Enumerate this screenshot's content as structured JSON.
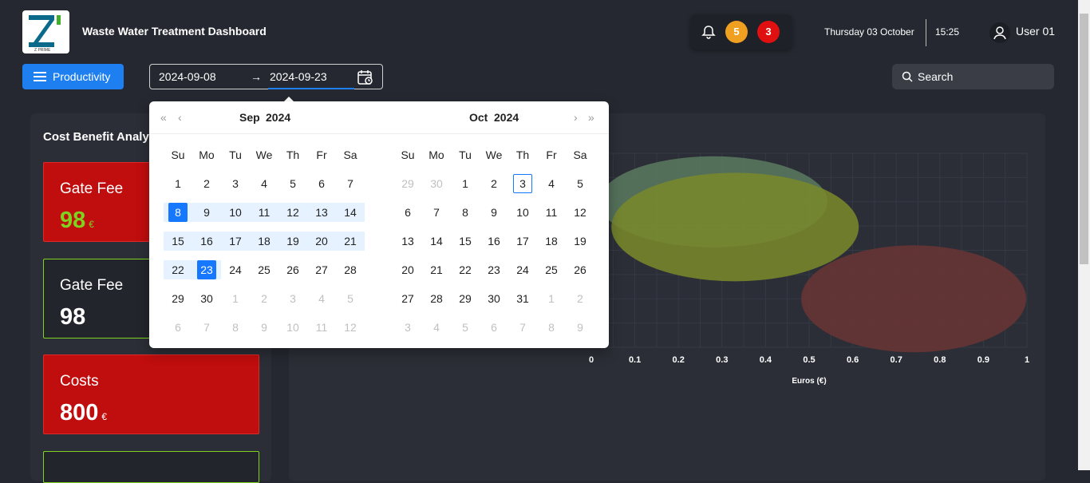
{
  "header": {
    "logo_text": "Z PRIME",
    "title": "Waste Water Treatment Dashboard",
    "notif_warn_count": "5",
    "notif_alert_count": "3",
    "date": "Thursday 03 October",
    "time": "15:25",
    "user": "User 01",
    "icons": [
      "bell-icon",
      "user-icon",
      "menu-icon",
      "calendar-icon",
      "search-icon"
    ],
    "colors": {
      "accent": "#1d7ff0",
      "warn": "#f0a020",
      "alert": "#e01010"
    }
  },
  "toolbar": {
    "productivity_label": "Productivity",
    "range_start": "2024-09-08",
    "range_arrow": "→",
    "range_end": "2024-09-23",
    "search_label": "Search"
  },
  "left_panel": {
    "title": "Cost Benefit Analy",
    "cards": [
      {
        "label": "Gate Fee",
        "value": "98",
        "unit": "€"
      },
      {
        "label": "Gate Fee",
        "value": "98",
        "unit": ""
      },
      {
        "label": "Costs",
        "value": "800",
        "unit": "€"
      }
    ]
  },
  "chart_data": {
    "type": "scatter",
    "xlabel": "Euros (€)",
    "xticks": [
      "0",
      "0.1",
      "0.2",
      "0.3",
      "0.4",
      "0.5",
      "0.6",
      "0.7",
      "0.8",
      "0.9",
      "1"
    ],
    "xlim": [
      0,
      1
    ],
    "bubbles": [
      {
        "x": 0.28,
        "y": 0.75,
        "color": "#5a7a60"
      },
      {
        "x": 0.33,
        "y": 0.62,
        "color": "#7a8a2a"
      },
      {
        "x": 0.74,
        "y": 0.25,
        "color": "#6a3434"
      }
    ]
  },
  "calendar": {
    "left_month": "Sep",
    "left_year": "2024",
    "right_month": "Oct",
    "right_year": "2024",
    "weekdays": [
      "Su",
      "Mo",
      "Tu",
      "We",
      "Th",
      "Fr",
      "Sa"
    ],
    "left_days": [
      [
        "1",
        "2",
        "3",
        "4",
        "5",
        "6",
        "7"
      ],
      [
        "8",
        "9",
        "10",
        "11",
        "12",
        "13",
        "14"
      ],
      [
        "15",
        "16",
        "17",
        "18",
        "19",
        "20",
        "21"
      ],
      [
        "22",
        "23",
        "24",
        "25",
        "26",
        "27",
        "28"
      ],
      [
        "29",
        "30",
        "1",
        "2",
        "3",
        "4",
        "5"
      ],
      [
        "6",
        "7",
        "8",
        "9",
        "10",
        "11",
        "12"
      ]
    ],
    "right_days": [
      [
        "29",
        "30",
        "1",
        "2",
        "3",
        "4",
        "5"
      ],
      [
        "6",
        "7",
        "8",
        "9",
        "10",
        "11",
        "12"
      ],
      [
        "13",
        "14",
        "15",
        "16",
        "17",
        "18",
        "19"
      ],
      [
        "20",
        "21",
        "22",
        "23",
        "24",
        "25",
        "26"
      ],
      [
        "27",
        "28",
        "29",
        "30",
        "31",
        "1",
        "2"
      ],
      [
        "3",
        "4",
        "5",
        "6",
        "7",
        "8",
        "9"
      ]
    ],
    "prev_year": "«",
    "prev_month": "‹",
    "next_month": "›",
    "next_year": "»"
  }
}
